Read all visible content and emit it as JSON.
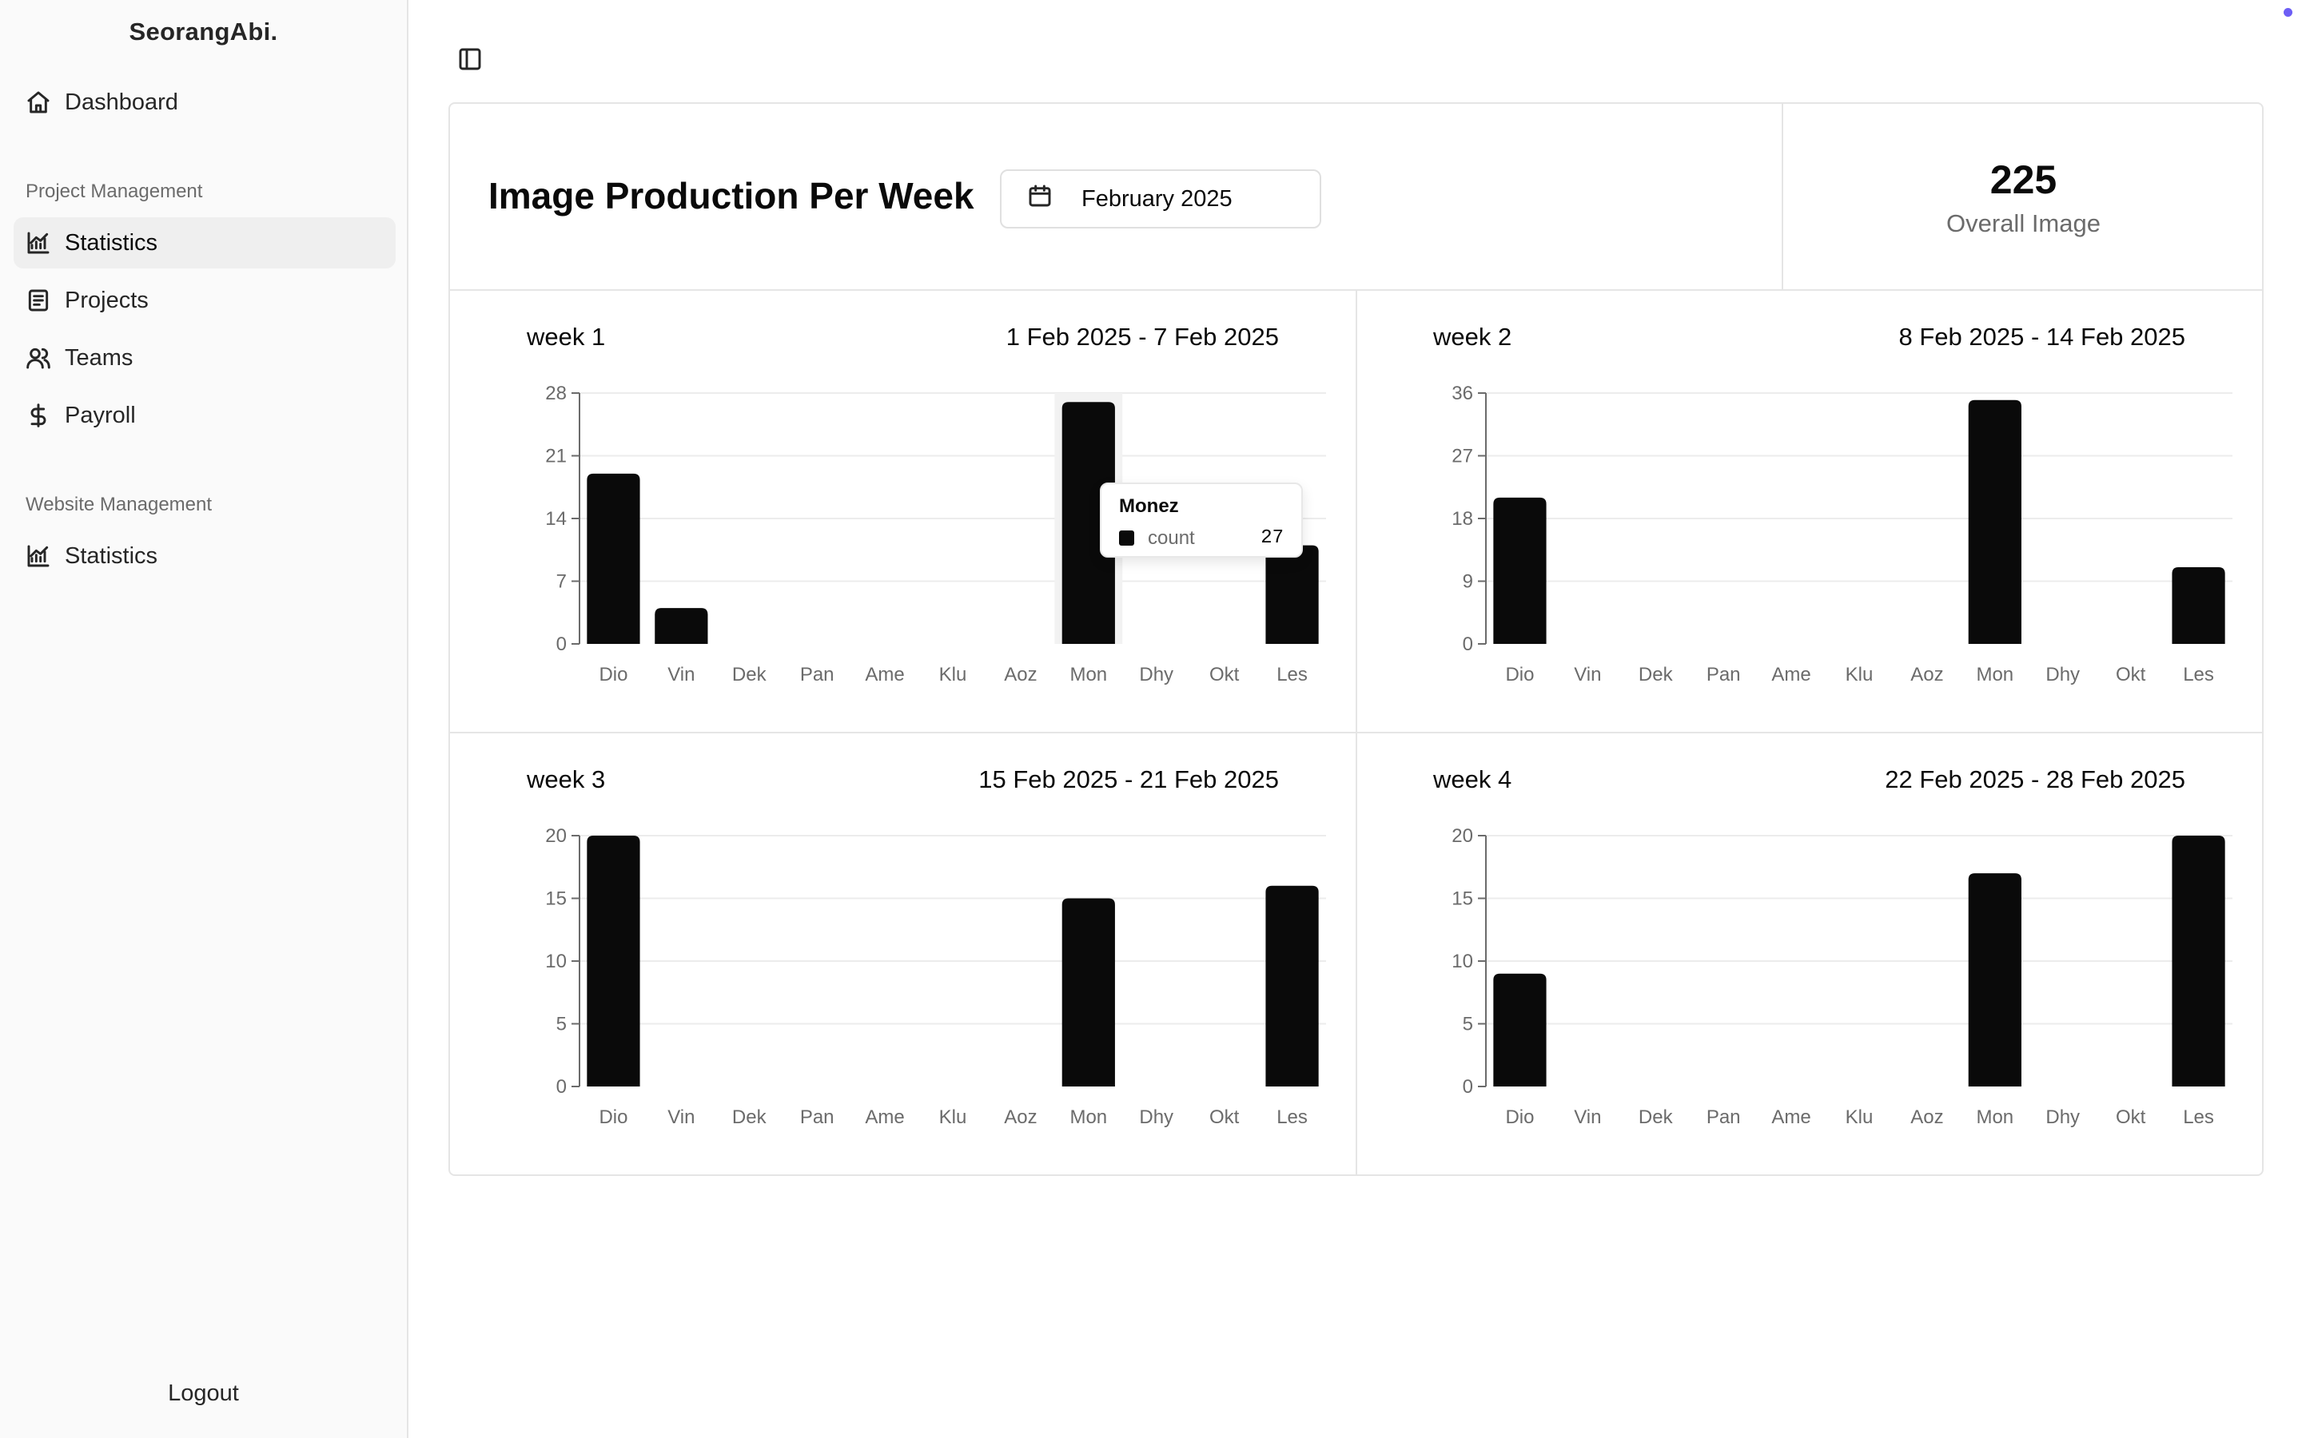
{
  "app": {
    "brand": "SeorangAbi."
  },
  "sidebar": {
    "top_items": [
      {
        "label": "Dashboard",
        "icon": "home-icon"
      }
    ],
    "sections": [
      {
        "label": "Project Management",
        "items": [
          {
            "label": "Statistics",
            "icon": "chart-icon",
            "active": true
          },
          {
            "label": "Projects",
            "icon": "document-icon"
          },
          {
            "label": "Teams",
            "icon": "users-icon"
          },
          {
            "label": "Payroll",
            "icon": "dollar-icon"
          }
        ]
      },
      {
        "label": "Website Management",
        "items": [
          {
            "label": "Statistics",
            "icon": "chart-icon"
          }
        ]
      }
    ],
    "logout_label": "Logout"
  },
  "header": {
    "title": "Image Production Per Week",
    "date_picker_value": "February 2025",
    "overall": {
      "value": "225",
      "label": "Overall Image"
    }
  },
  "colors": {
    "bar": "#0a0a0a",
    "grid": "#ececec",
    "axis": "#6b6b6b",
    "accent_dot": "#6d5ef5"
  },
  "tooltip": {
    "name": "Monez",
    "key": "count",
    "value": "27"
  },
  "chart_data": [
    {
      "type": "bar",
      "title": "week 1",
      "subtitle": "1 Feb 2025 - 7 Feb 2025",
      "categories": [
        "Dio",
        "Vin",
        "Dek",
        "Pan",
        "Ame",
        "Klu",
        "Aoz",
        "Mon",
        "Dhy",
        "Okt",
        "Les"
      ],
      "series": [
        {
          "name": "count",
          "values": [
            19,
            4,
            0,
            0,
            0,
            0,
            0,
            27,
            0,
            0,
            11
          ]
        }
      ],
      "ylim": [
        0,
        28
      ],
      "yticks": [
        0,
        7,
        14,
        21,
        28
      ],
      "grid": true,
      "highlight_index": 7
    },
    {
      "type": "bar",
      "title": "week 2",
      "subtitle": "8 Feb 2025 - 14 Feb 2025",
      "categories": [
        "Dio",
        "Vin",
        "Dek",
        "Pan",
        "Ame",
        "Klu",
        "Aoz",
        "Mon",
        "Dhy",
        "Okt",
        "Les"
      ],
      "series": [
        {
          "name": "count",
          "values": [
            21,
            0,
            0,
            0,
            0,
            0,
            0,
            35,
            0,
            0,
            11
          ]
        }
      ],
      "ylim": [
        0,
        36
      ],
      "yticks": [
        0,
        9,
        18,
        27,
        36
      ],
      "grid": true
    },
    {
      "type": "bar",
      "title": "week 3",
      "subtitle": "15 Feb 2025 - 21 Feb 2025",
      "categories": [
        "Dio",
        "Vin",
        "Dek",
        "Pan",
        "Ame",
        "Klu",
        "Aoz",
        "Mon",
        "Dhy",
        "Okt",
        "Les"
      ],
      "series": [
        {
          "name": "count",
          "values": [
            20,
            0,
            0,
            0,
            0,
            0,
            0,
            15,
            0,
            0,
            16
          ]
        }
      ],
      "ylim": [
        0,
        20
      ],
      "yticks": [
        0,
        5,
        10,
        15,
        20
      ],
      "grid": true
    },
    {
      "type": "bar",
      "title": "week 4",
      "subtitle": "22 Feb 2025 - 28 Feb 2025",
      "categories": [
        "Dio",
        "Vin",
        "Dek",
        "Pan",
        "Ame",
        "Klu",
        "Aoz",
        "Mon",
        "Dhy",
        "Okt",
        "Les"
      ],
      "series": [
        {
          "name": "count",
          "values": [
            9,
            0,
            0,
            0,
            0,
            0,
            0,
            17,
            0,
            0,
            20
          ]
        }
      ],
      "ylim": [
        0,
        20
      ],
      "yticks": [
        0,
        5,
        10,
        15,
        20
      ],
      "grid": true
    }
  ]
}
